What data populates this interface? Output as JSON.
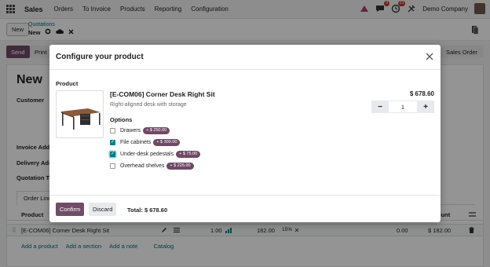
{
  "topbar": {
    "app_name": "Sales",
    "menu": [
      "Orders",
      "To Invoice",
      "Products",
      "Reporting",
      "Configuration"
    ],
    "messages_badge": "9",
    "activities_badge": "23",
    "company": "Demo Company"
  },
  "breadcrumb": {
    "new_button": "New",
    "parent": "Quotations",
    "current": "New"
  },
  "form": {
    "send_label": "Send",
    "print_label": "Print",
    "sales_order_label": "Sales Order",
    "title": "New",
    "customer_label": "Customer",
    "invoice_address_label": "Invoice Addr",
    "delivery_address_label": "Delivery Add",
    "quotation_template_label": "Quotation Te",
    "tab_order_lines": "Order Line",
    "columns": {
      "product": "Product",
      "amount": "ount"
    },
    "line": {
      "product": "[E-COM06] Corner Desk Right Sit",
      "quantity": "1.00",
      "unit_price": "182.00",
      "discount": "15%",
      "taxes": "0.00",
      "subtotal": "$ 182.00"
    },
    "links": [
      "Add a product",
      "Add a section",
      "Add a note",
      "Catalog"
    ]
  },
  "modal": {
    "title": "Configure your product",
    "product_section_label": "Product",
    "product_name": "[E-COM06] Corner Desk Right Sit",
    "product_description": "Right-aligned desk with storage",
    "price": "$ 678.60",
    "quantity": "1",
    "options_label": "Options",
    "options": [
      {
        "label": "Drawers",
        "price": "+ $ 250.00",
        "checked": false
      },
      {
        "label": "File cabinets",
        "price": "+ $ 300.00",
        "checked": true
      },
      {
        "label": "Under-desk pedestals",
        "price": "+ $ 75.00",
        "checked": true
      },
      {
        "label": "Overhead shelves",
        "price": "+ $ 225.00",
        "checked": false
      }
    ],
    "confirm_label": "Confirm",
    "discard_label": "Discard",
    "total_label": "Total: $ 678.60"
  },
  "colors": {
    "primary": "#714b67",
    "accent": "#017e84"
  }
}
